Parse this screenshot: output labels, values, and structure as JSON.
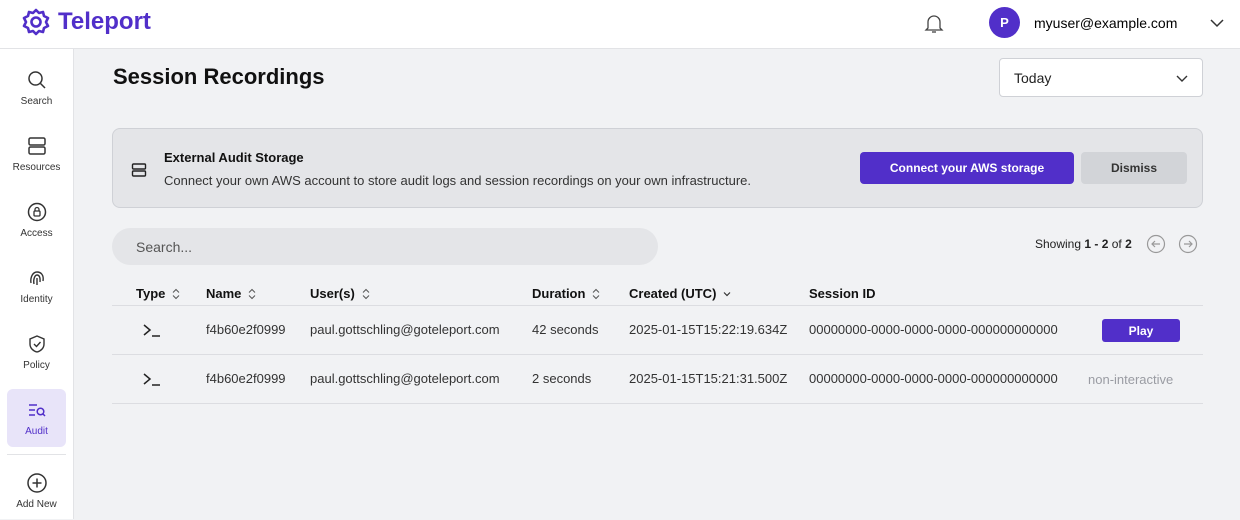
{
  "app": {
    "logo_text": "Teleport",
    "brand_color": "#512fc9"
  },
  "header": {
    "avatar_initial": "P",
    "user_email": "myuser@example.com",
    "icons": [
      "bell-icon",
      "chevron-down-icon"
    ]
  },
  "sidebar": {
    "items": [
      {
        "label": "Search",
        "icon": "search-icon",
        "active": false
      },
      {
        "label": "Resources",
        "icon": "server-icon",
        "active": false
      },
      {
        "label": "Access",
        "icon": "lock-circle-icon",
        "active": false
      },
      {
        "label": "Identity",
        "icon": "fingerprint-icon",
        "active": false
      },
      {
        "label": "Policy",
        "icon": "shield-check-icon",
        "active": false
      },
      {
        "label": "Audit",
        "icon": "list-search-icon",
        "active": true
      },
      {
        "label": "Add New",
        "icon": "plus-circle-icon",
        "active": false
      }
    ]
  },
  "main": {
    "title": "Session Recordings",
    "range_select": {
      "value": "Today"
    },
    "banner": {
      "title": "External Audit Storage",
      "text": "Connect your own AWS account to store audit logs and session recordings on your own infrastructure.",
      "primary_label": "Connect your AWS storage",
      "secondary_label": "Dismiss"
    },
    "search": {
      "placeholder": "Search...",
      "value": ""
    },
    "pager": {
      "prefix": "Showing ",
      "range": "1 - 2",
      "of": " of ",
      "total": "2"
    },
    "table": {
      "columns": [
        "Type",
        "Name",
        "User(s)",
        "Duration",
        "Created (UTC)",
        "Session ID"
      ],
      "rows": [
        {
          "type_icon": "terminal-icon",
          "name": "f4b60e2f0999",
          "users": "paul.gottschling@goteleport.com",
          "duration": "42 seconds",
          "created": "2025-01-15T15:22:19.634Z",
          "session_id": "00000000-0000-0000-0000-000000000000",
          "action": "Play"
        },
        {
          "type_icon": "terminal-icon",
          "name": "f4b60e2f0999",
          "users": "paul.gottschling@goteleport.com",
          "duration": "2 seconds",
          "created": "2025-01-15T15:21:31.500Z",
          "session_id": "00000000-0000-0000-0000-000000000000",
          "action": "non-interactive"
        }
      ]
    }
  }
}
